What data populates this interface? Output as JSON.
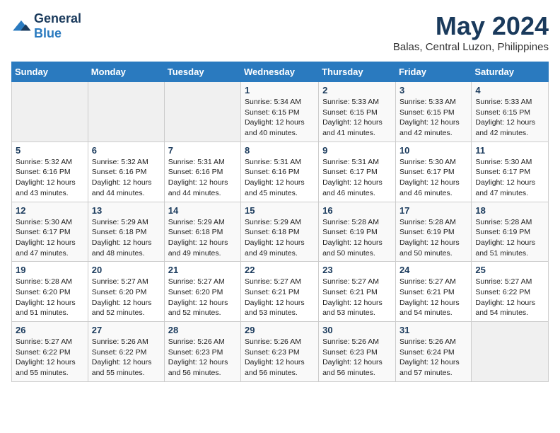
{
  "header": {
    "logo_general": "General",
    "logo_blue": "Blue",
    "month_year": "May 2024",
    "location": "Balas, Central Luzon, Philippines"
  },
  "weekdays": [
    "Sunday",
    "Monday",
    "Tuesday",
    "Wednesday",
    "Thursday",
    "Friday",
    "Saturday"
  ],
  "weeks": [
    [
      {
        "day": "",
        "sunrise": "",
        "sunset": "",
        "daylight": ""
      },
      {
        "day": "",
        "sunrise": "",
        "sunset": "",
        "daylight": ""
      },
      {
        "day": "",
        "sunrise": "",
        "sunset": "",
        "daylight": ""
      },
      {
        "day": "1",
        "sunrise": "Sunrise: 5:34 AM",
        "sunset": "Sunset: 6:15 PM",
        "daylight": "Daylight: 12 hours and 40 minutes."
      },
      {
        "day": "2",
        "sunrise": "Sunrise: 5:33 AM",
        "sunset": "Sunset: 6:15 PM",
        "daylight": "Daylight: 12 hours and 41 minutes."
      },
      {
        "day": "3",
        "sunrise": "Sunrise: 5:33 AM",
        "sunset": "Sunset: 6:15 PM",
        "daylight": "Daylight: 12 hours and 42 minutes."
      },
      {
        "day": "4",
        "sunrise": "Sunrise: 5:33 AM",
        "sunset": "Sunset: 6:15 PM",
        "daylight": "Daylight: 12 hours and 42 minutes."
      }
    ],
    [
      {
        "day": "5",
        "sunrise": "Sunrise: 5:32 AM",
        "sunset": "Sunset: 6:16 PM",
        "daylight": "Daylight: 12 hours and 43 minutes."
      },
      {
        "day": "6",
        "sunrise": "Sunrise: 5:32 AM",
        "sunset": "Sunset: 6:16 PM",
        "daylight": "Daylight: 12 hours and 44 minutes."
      },
      {
        "day": "7",
        "sunrise": "Sunrise: 5:31 AM",
        "sunset": "Sunset: 6:16 PM",
        "daylight": "Daylight: 12 hours and 44 minutes."
      },
      {
        "day": "8",
        "sunrise": "Sunrise: 5:31 AM",
        "sunset": "Sunset: 6:16 PM",
        "daylight": "Daylight: 12 hours and 45 minutes."
      },
      {
        "day": "9",
        "sunrise": "Sunrise: 5:31 AM",
        "sunset": "Sunset: 6:17 PM",
        "daylight": "Daylight: 12 hours and 46 minutes."
      },
      {
        "day": "10",
        "sunrise": "Sunrise: 5:30 AM",
        "sunset": "Sunset: 6:17 PM",
        "daylight": "Daylight: 12 hours and 46 minutes."
      },
      {
        "day": "11",
        "sunrise": "Sunrise: 5:30 AM",
        "sunset": "Sunset: 6:17 PM",
        "daylight": "Daylight: 12 hours and 47 minutes."
      }
    ],
    [
      {
        "day": "12",
        "sunrise": "Sunrise: 5:30 AM",
        "sunset": "Sunset: 6:17 PM",
        "daylight": "Daylight: 12 hours and 47 minutes."
      },
      {
        "day": "13",
        "sunrise": "Sunrise: 5:29 AM",
        "sunset": "Sunset: 6:18 PM",
        "daylight": "Daylight: 12 hours and 48 minutes."
      },
      {
        "day": "14",
        "sunrise": "Sunrise: 5:29 AM",
        "sunset": "Sunset: 6:18 PM",
        "daylight": "Daylight: 12 hours and 49 minutes."
      },
      {
        "day": "15",
        "sunrise": "Sunrise: 5:29 AM",
        "sunset": "Sunset: 6:18 PM",
        "daylight": "Daylight: 12 hours and 49 minutes."
      },
      {
        "day": "16",
        "sunrise": "Sunrise: 5:28 AM",
        "sunset": "Sunset: 6:19 PM",
        "daylight": "Daylight: 12 hours and 50 minutes."
      },
      {
        "day": "17",
        "sunrise": "Sunrise: 5:28 AM",
        "sunset": "Sunset: 6:19 PM",
        "daylight": "Daylight: 12 hours and 50 minutes."
      },
      {
        "day": "18",
        "sunrise": "Sunrise: 5:28 AM",
        "sunset": "Sunset: 6:19 PM",
        "daylight": "Daylight: 12 hours and 51 minutes."
      }
    ],
    [
      {
        "day": "19",
        "sunrise": "Sunrise: 5:28 AM",
        "sunset": "Sunset: 6:20 PM",
        "daylight": "Daylight: 12 hours and 51 minutes."
      },
      {
        "day": "20",
        "sunrise": "Sunrise: 5:27 AM",
        "sunset": "Sunset: 6:20 PM",
        "daylight": "Daylight: 12 hours and 52 minutes."
      },
      {
        "day": "21",
        "sunrise": "Sunrise: 5:27 AM",
        "sunset": "Sunset: 6:20 PM",
        "daylight": "Daylight: 12 hours and 52 minutes."
      },
      {
        "day": "22",
        "sunrise": "Sunrise: 5:27 AM",
        "sunset": "Sunset: 6:21 PM",
        "daylight": "Daylight: 12 hours and 53 minutes."
      },
      {
        "day": "23",
        "sunrise": "Sunrise: 5:27 AM",
        "sunset": "Sunset: 6:21 PM",
        "daylight": "Daylight: 12 hours and 53 minutes."
      },
      {
        "day": "24",
        "sunrise": "Sunrise: 5:27 AM",
        "sunset": "Sunset: 6:21 PM",
        "daylight": "Daylight: 12 hours and 54 minutes."
      },
      {
        "day": "25",
        "sunrise": "Sunrise: 5:27 AM",
        "sunset": "Sunset: 6:22 PM",
        "daylight": "Daylight: 12 hours and 54 minutes."
      }
    ],
    [
      {
        "day": "26",
        "sunrise": "Sunrise: 5:27 AM",
        "sunset": "Sunset: 6:22 PM",
        "daylight": "Daylight: 12 hours and 55 minutes."
      },
      {
        "day": "27",
        "sunrise": "Sunrise: 5:26 AM",
        "sunset": "Sunset: 6:22 PM",
        "daylight": "Daylight: 12 hours and 55 minutes."
      },
      {
        "day": "28",
        "sunrise": "Sunrise: 5:26 AM",
        "sunset": "Sunset: 6:23 PM",
        "daylight": "Daylight: 12 hours and 56 minutes."
      },
      {
        "day": "29",
        "sunrise": "Sunrise: 5:26 AM",
        "sunset": "Sunset: 6:23 PM",
        "daylight": "Daylight: 12 hours and 56 minutes."
      },
      {
        "day": "30",
        "sunrise": "Sunrise: 5:26 AM",
        "sunset": "Sunset: 6:23 PM",
        "daylight": "Daylight: 12 hours and 56 minutes."
      },
      {
        "day": "31",
        "sunrise": "Sunrise: 5:26 AM",
        "sunset": "Sunset: 6:24 PM",
        "daylight": "Daylight: 12 hours and 57 minutes."
      },
      {
        "day": "",
        "sunrise": "",
        "sunset": "",
        "daylight": ""
      }
    ]
  ]
}
